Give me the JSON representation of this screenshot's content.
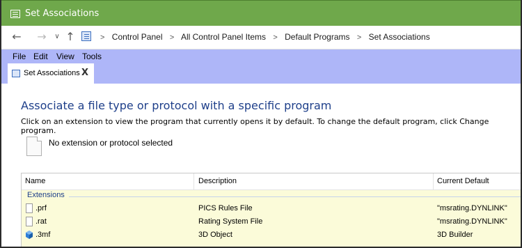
{
  "window": {
    "title": "Set Associations",
    "title_bar_color": "#6fa84b"
  },
  "address_bar": {
    "back_icon": "arrow-left",
    "forward_icon": "arrow-right",
    "history_icon": "chevron-down",
    "up_icon": "arrow-up",
    "breadcrumbs": [
      "Control Panel",
      "All Control Panel Items",
      "Default Programs",
      "Set Associations"
    ]
  },
  "menu": {
    "items": [
      "File",
      "Edit",
      "View",
      "Tools"
    ],
    "bar_color": "#aeb6f8"
  },
  "tabs": [
    {
      "label": "Set Associations",
      "close": "X"
    }
  ],
  "content": {
    "heading": "Associate a file type or protocol with a specific program",
    "description": "Click on an extension to view the program that currently opens it by default. To change the default program, click Change program.",
    "selected_text": "No extension or protocol selected"
  },
  "list": {
    "columns": [
      "Name",
      "Description",
      "Current Default"
    ],
    "group": "Extensions",
    "rows": [
      {
        "name": ".prf",
        "description": "PICS Rules File",
        "current_default": "\"msrating.DYNLINK\"",
        "icon": "document-icon"
      },
      {
        "name": ".rat",
        "description": "Rating System File",
        "current_default": "\"msrating.DYNLINK\"",
        "icon": "document-icon"
      },
      {
        "name": ".3mf",
        "description": "3D Object",
        "current_default": "3D Builder",
        "icon": "3d-builder-icon"
      }
    ],
    "row_background": "#fbfbd9"
  }
}
